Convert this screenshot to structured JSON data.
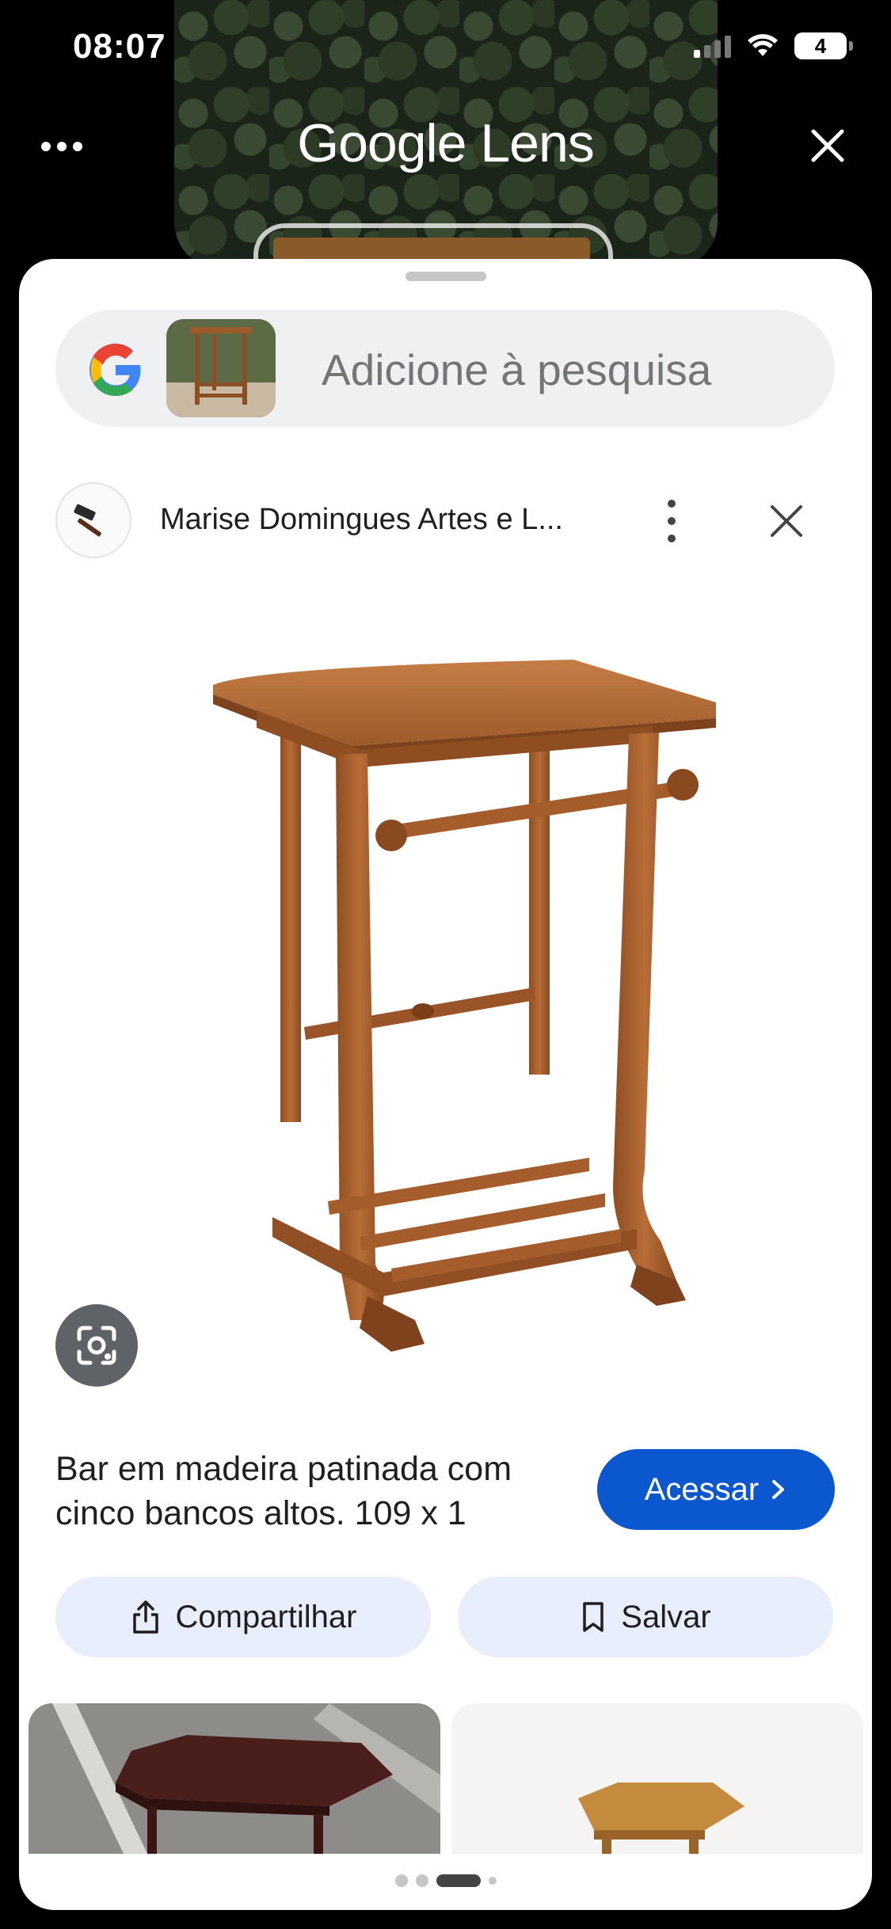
{
  "status_bar": {
    "time": "08:07",
    "battery": "4"
  },
  "header": {
    "title": "Google Lens"
  },
  "search": {
    "placeholder": "Adicione à pesquisa"
  },
  "source": {
    "name": "Marise Domingues Artes e L..."
  },
  "product": {
    "description": "Bar em madeira patinada com cinco bancos altos. 109 x 1",
    "visit_label": "Acessar"
  },
  "actions": {
    "share_label": "Compartilhar",
    "save_label": "Salvar"
  },
  "colors": {
    "accent": "#0b57d0",
    "chip_bg": "#e8eefb",
    "search_bg": "#eef0f1",
    "wood": "#a9632f"
  },
  "icons": [
    "more-horizontal-icon",
    "close-icon",
    "google-g-icon",
    "hammer-icon",
    "more-vertical-icon",
    "lens-camera-icon",
    "chevron-right-icon",
    "share-icon",
    "bookmark-icon"
  ],
  "pager": {
    "total": 4,
    "active_index": 2
  }
}
